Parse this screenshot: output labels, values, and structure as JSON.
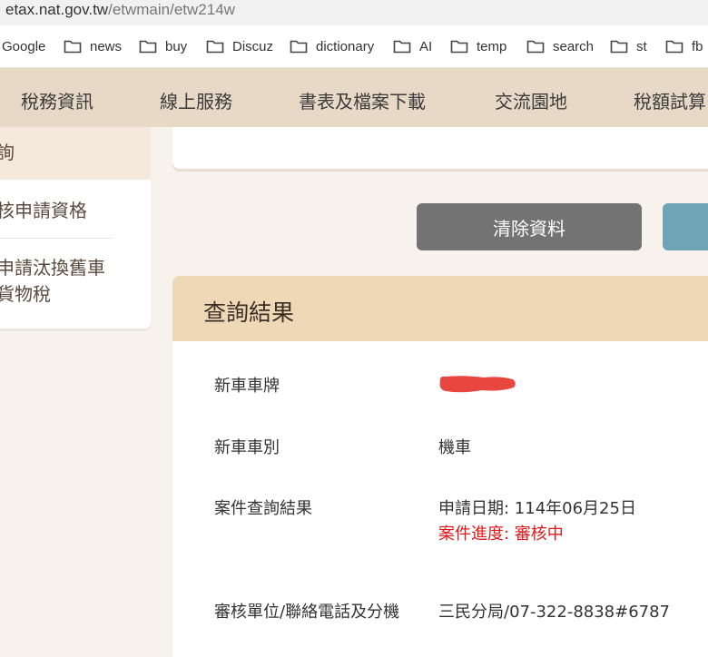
{
  "browser": {
    "url_host": "etax.nat.gov.tw",
    "url_path": "/etwmain/etw214w",
    "bookmarks": [
      {
        "label": "Google",
        "icon": "folder-icon"
      },
      {
        "label": "news",
        "icon": "folder-icon"
      },
      {
        "label": "buy",
        "icon": "folder-icon"
      },
      {
        "label": "Discuz",
        "icon": "folder-icon"
      },
      {
        "label": "dictionary",
        "icon": "folder-icon"
      },
      {
        "label": "AI",
        "icon": "folder-icon"
      },
      {
        "label": "temp",
        "icon": "folder-icon"
      },
      {
        "label": "search",
        "icon": "folder-icon"
      },
      {
        "label": "st",
        "icon": "folder-icon"
      },
      {
        "label": "fb",
        "icon": "folder-icon"
      }
    ]
  },
  "nav": {
    "items": [
      "稅務資訊",
      "線上服務",
      "書表及檔案下載",
      "交流園地",
      "稅額試算"
    ]
  },
  "sidebar": {
    "active_label": "詢",
    "items": [
      {
        "label": "核申請資格"
      },
      {
        "label_line1": "申請汰換舊車",
        "label_line2": "貨物稅"
      }
    ]
  },
  "actions": {
    "clear_label": "清除資料"
  },
  "result": {
    "title": "查詢結果",
    "rows": {
      "plate_label": "新車車牌",
      "type_label": "新車車別",
      "type_value": "機車",
      "status_label": "案件查詢結果",
      "apply_date": "申請日期: 114年06月25日",
      "progress": "案件進度: 審核中",
      "office_label": "審核單位/聯絡電話及分機",
      "office_value": "三民分局/07-322-8838#6787"
    }
  },
  "colors": {
    "nav_bg": "#e8d9c7",
    "result_header": "#efd8b6",
    "clear_button": "#737373",
    "query_button": "#6fa3b6",
    "status_red": "#e01a1a",
    "redaction": "#e8463f"
  }
}
